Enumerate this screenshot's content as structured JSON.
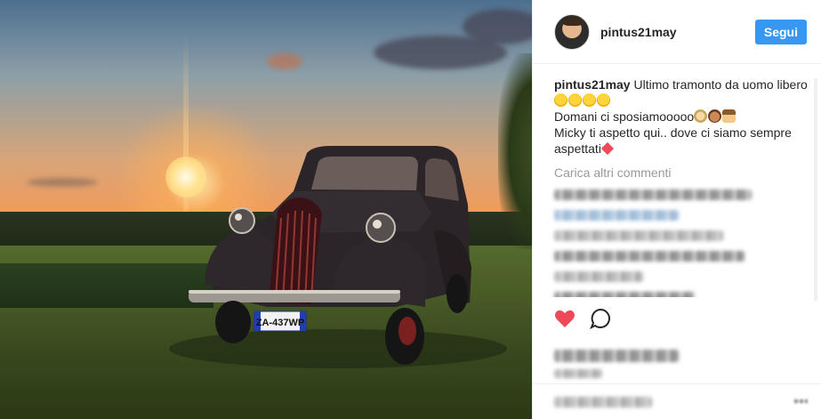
{
  "post": {
    "photo_alt": "",
    "header": {
      "username": "pintus21may",
      "follow_label": "Segui"
    },
    "caption": {
      "username": "pintus21may",
      "line1": "Ultimo tramonto da uomo libero",
      "line2": "Domani ci sposiamooooo",
      "line3": "Micky ti aspetto qui.. dove ci siamo sempre aspettati"
    },
    "load_more_label": "Carica altri commenti",
    "plate": "ZA-437WP",
    "colors": {
      "accent": "#3897f0",
      "heart": "#ed4956",
      "muted": "#999999",
      "border": "#efefef"
    },
    "icons": {
      "like": "heart-icon",
      "comment": "comment-icon"
    }
  }
}
